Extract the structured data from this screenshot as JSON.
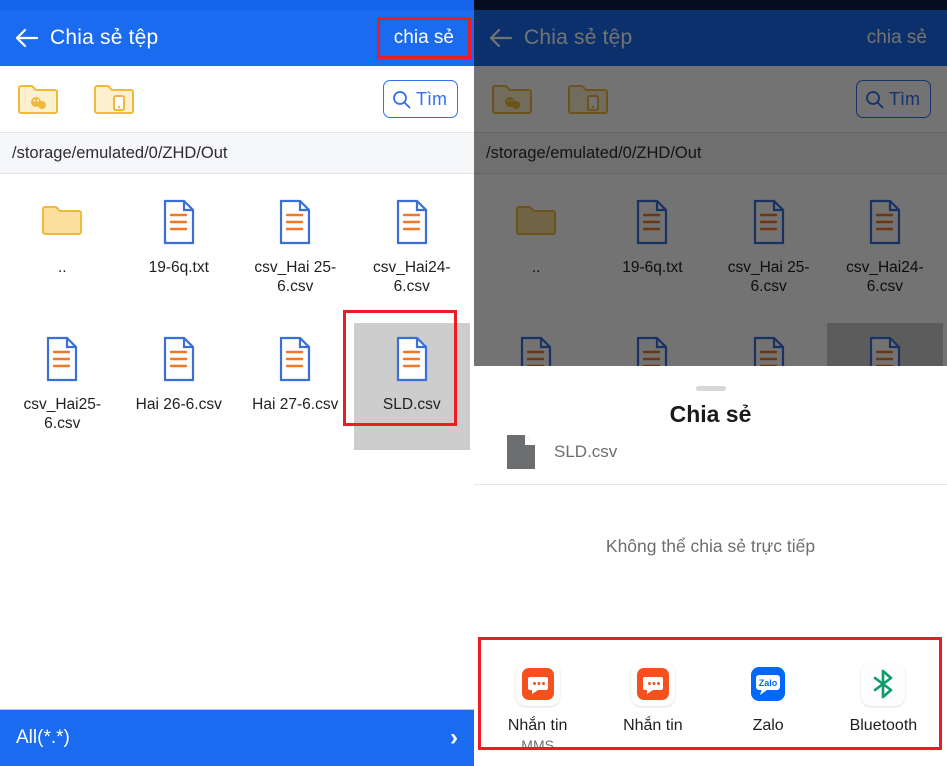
{
  "left_panel": {
    "appbar": {
      "back_icon": "arrow-left-icon",
      "title": "Chia sẻ tệp",
      "action_label": "chia sẻ"
    },
    "toolbar": {
      "folder_chat_icon": "folder-chat-icon",
      "folder_device_icon": "folder-device-icon",
      "search_icon": "search-icon",
      "search_label": "Tìm"
    },
    "path": "/storage/emulated/0/ZHD/Out",
    "files": [
      {
        "name": "..",
        "type": "folder",
        "selected": false
      },
      {
        "name": "19-6q.txt",
        "type": "file",
        "selected": false
      },
      {
        "name": "csv_Hai 25-6.csv",
        "type": "file",
        "selected": false
      },
      {
        "name": "csv_Hai24-6.csv",
        "type": "file",
        "selected": false
      },
      {
        "name": "csv_Hai25-6.csv",
        "type": "file",
        "selected": false
      },
      {
        "name": "Hai 26-6.csv",
        "type": "file",
        "selected": false
      },
      {
        "name": "Hai 27-6.csv",
        "type": "file",
        "selected": false
      },
      {
        "name": "SLD.csv",
        "type": "file",
        "selected": true
      }
    ],
    "filterbar": {
      "label": "All(*.*)",
      "chevron": "›"
    }
  },
  "right_panel": {
    "appbar": {
      "back_icon": "arrow-left-icon",
      "title": "Chia sẻ tệp",
      "action_label": "chia sẻ"
    },
    "toolbar": {
      "search_label": "Tìm"
    },
    "path": "/storage/emulated/0/ZHD/Out",
    "files": [
      {
        "name": "..",
        "type": "folder"
      },
      {
        "name": "19-6q.txt",
        "type": "file"
      },
      {
        "name": "csv_Hai 25-6.csv",
        "type": "file"
      },
      {
        "name": "csv_Hai24-6.csv",
        "type": "file"
      },
      {
        "name": "",
        "type": "file"
      },
      {
        "name": "",
        "type": "file"
      },
      {
        "name": "",
        "type": "file"
      },
      {
        "name": "",
        "type": "file"
      }
    ],
    "share_sheet": {
      "title": "Chia sẻ",
      "file_name": "SLD.csv",
      "file_icon": "document-icon",
      "message": "Không thể chia sẻ trực tiếp",
      "apps": [
        {
          "label": "Nhắn tin",
          "sublabel": "MMS",
          "icon": "messaging-icon"
        },
        {
          "label": "Nhắn tin",
          "sublabel": "",
          "icon": "messaging-icon"
        },
        {
          "label": "Zalo",
          "sublabel": "",
          "icon": "zalo-icon"
        },
        {
          "label": "Bluetooth",
          "sublabel": "",
          "icon": "bluetooth-icon"
        }
      ]
    }
  },
  "colors": {
    "appbar_blue": "#1a6bf0",
    "annotation_red": "#ee1c22",
    "selection_grey": "#cdcdcd",
    "doc_outline_blue": "#3a6fd8",
    "doc_line_orange": "#f07828",
    "folder_yellow": "#f5c342",
    "messaging_orange": "#f4511e",
    "zalo_blue": "#0068ff",
    "bluetooth_teal": "#0f9d6a"
  }
}
